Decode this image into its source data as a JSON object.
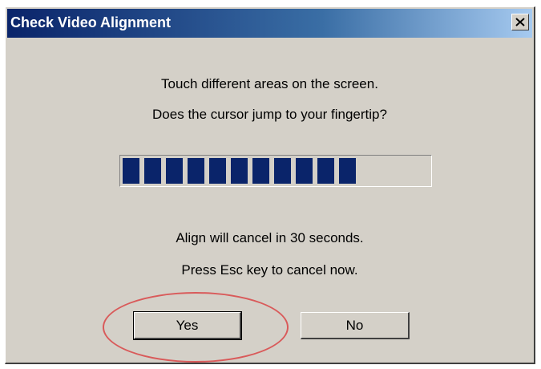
{
  "window": {
    "title": "Check Video Alignment"
  },
  "message": {
    "line1": "Touch different areas on the screen.",
    "line2": "Does the cursor jump to your fingertip?",
    "countdown": "Align will cancel in 30 seconds.",
    "escape_hint": "Press Esc key to cancel now."
  },
  "progress": {
    "filled_blocks": 11,
    "fraction": 0.78
  },
  "buttons": {
    "yes": "Yes",
    "no": "No"
  },
  "colors": {
    "progress_fill": "#0a246a",
    "annotation_circle": "#d95a5a"
  },
  "icons": {
    "close": "close-icon"
  }
}
